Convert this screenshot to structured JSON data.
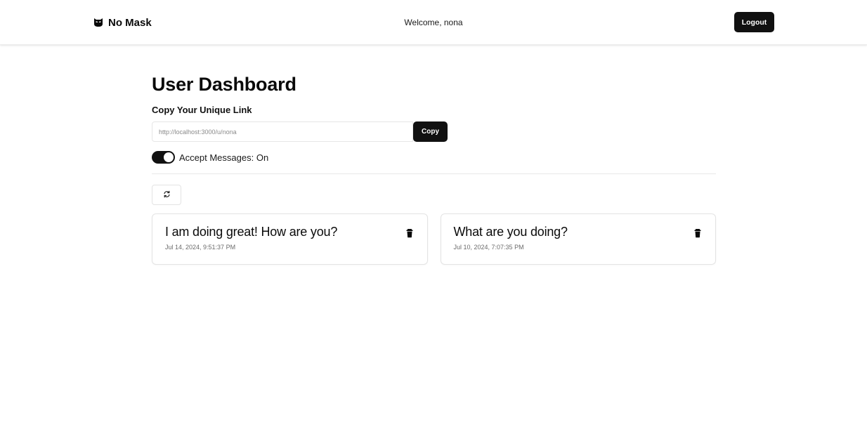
{
  "navbar": {
    "brand_name": "No Mask",
    "brand_icon": "mask-icon",
    "welcome_text": "Welcome, nona",
    "logout_label": "Logout"
  },
  "dashboard": {
    "title": "User Dashboard",
    "copy_section_label": "Copy Your Unique Link",
    "unique_link": "http://localhost:3000/u/nona",
    "copy_label": "Copy",
    "accept_messages_label": "Accept Messages: On",
    "accept_messages_on": true,
    "refresh_icon": "refresh-icon"
  },
  "messages": [
    {
      "text": "I am doing great! How are you?",
      "date": "Jul 14, 2024, 9:51:37 PM",
      "icon": "trash-icon"
    },
    {
      "text": "What are you doing?",
      "date": "Jul 10, 2024, 7:07:35 PM",
      "icon": "trash-icon"
    }
  ],
  "colors": {
    "primary": "#111111",
    "border": "#e3e3e3",
    "muted_text": "#6b6b6b"
  }
}
